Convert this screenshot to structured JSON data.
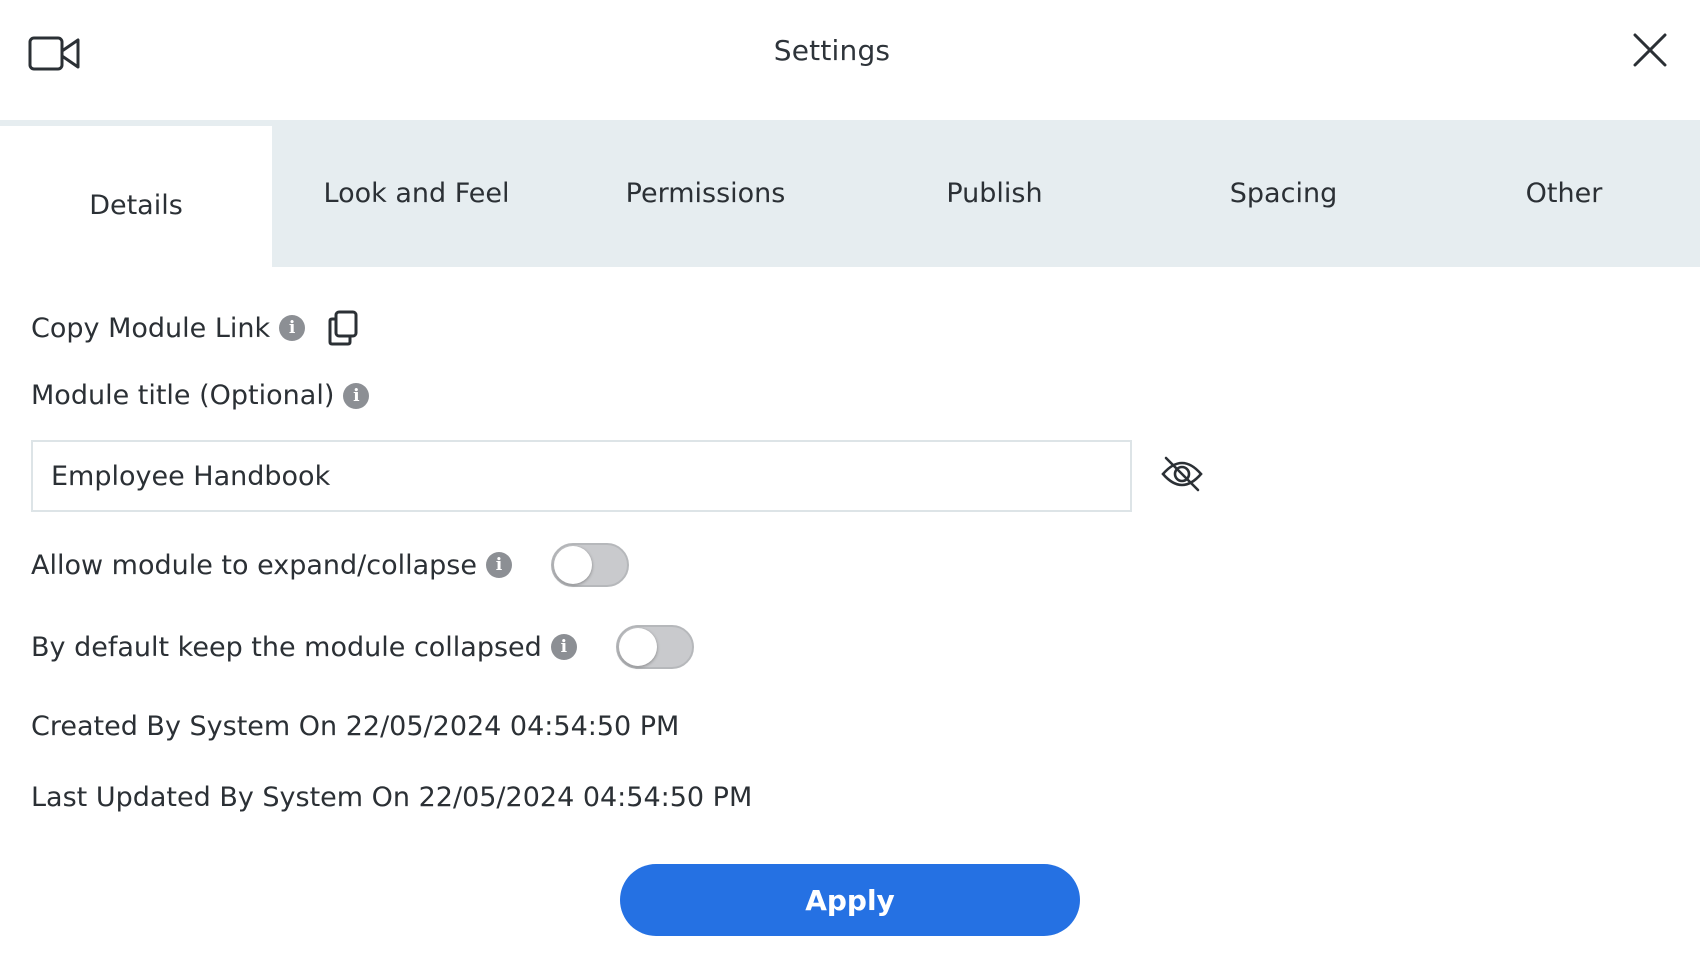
{
  "header": {
    "title": "Settings",
    "left_icon": "video-camera-icon",
    "close_icon": "close-icon"
  },
  "tabs": [
    {
      "label": "Details",
      "active": true
    },
    {
      "label": "Look and Feel",
      "active": false
    },
    {
      "label": "Permissions",
      "active": false
    },
    {
      "label": "Publish",
      "active": false
    },
    {
      "label": "Spacing",
      "active": false
    },
    {
      "label": "Other",
      "active": false
    }
  ],
  "details": {
    "copy_link_label": "Copy Module Link",
    "module_title_label": "Module title (Optional)",
    "module_title_value": "Employee Handbook",
    "allow_expand_label": "Allow module to expand/collapse",
    "allow_expand_on": false,
    "default_collapsed_label": "By default keep the module collapsed",
    "default_collapsed_on": false,
    "created_text": "Created By System On 22/05/2024 04:54:50 PM",
    "updated_text": "Last Updated By System On 22/05/2024 04:54:50 PM",
    "info_glyph": "i"
  },
  "footer": {
    "apply_label": "Apply"
  },
  "colors": {
    "accent": "#2571e3",
    "tab_bar": "#e6edf0",
    "toggle_off": "#c9cacd"
  }
}
